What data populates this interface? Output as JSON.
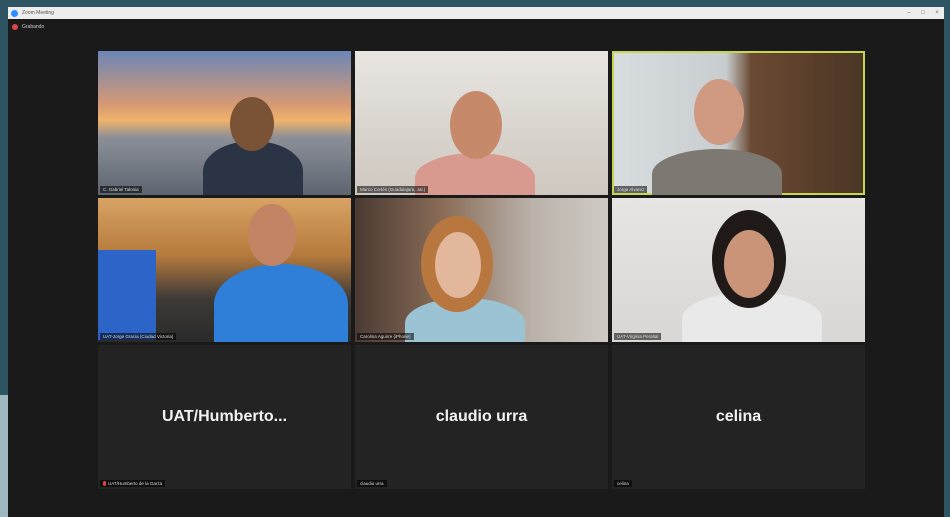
{
  "window": {
    "title": "Zoom Meeting"
  },
  "topbar": {
    "recording_label": "Grabando"
  },
  "participants": [
    {
      "name_tag": "C. Gabriel Talonia",
      "display_name": ""
    },
    {
      "name_tag": "Marco Cortés (Guadalajara, Jal.)",
      "display_name": ""
    },
    {
      "name_tag": "Jorge Alvarez",
      "display_name": ""
    },
    {
      "name_tag": "UAT-Jorge Gracia (Ciudad Victoria)",
      "display_name": ""
    },
    {
      "name_tag": "Carolina Aguirre (iPhone)",
      "display_name": ""
    },
    {
      "name_tag": "UAT-Virginia Peraltal",
      "display_name": ""
    },
    {
      "name_tag": "UAT/Humberto de la Garza",
      "display_name": "UAT/Humberto..."
    },
    {
      "name_tag": "claudio urra",
      "display_name": "claudio urra"
    },
    {
      "name_tag": "celina",
      "display_name": "celina"
    }
  ],
  "colors": {
    "active_speaker": "#c7d64c",
    "muted_mic": "#e0443f"
  }
}
